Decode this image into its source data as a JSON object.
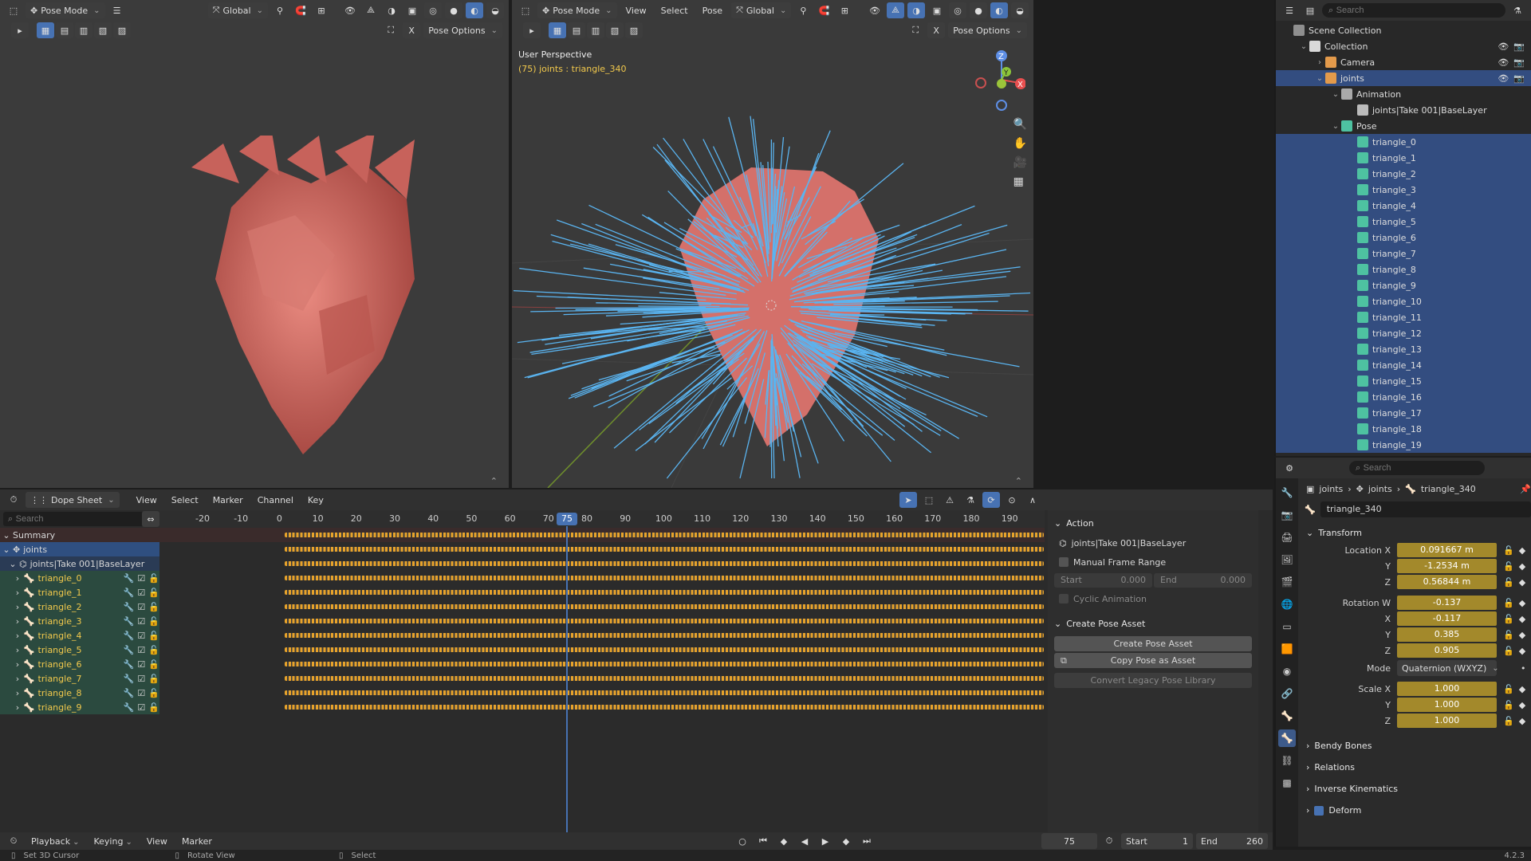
{
  "left_vp": {
    "mode": "Pose Mode",
    "orientation": "Global",
    "pose_options": "Pose Options"
  },
  "right_vp": {
    "mode": "Pose Mode",
    "menus": [
      "View",
      "Select",
      "Pose"
    ],
    "orientation": "Global",
    "pose_options": "Pose Options",
    "perspective": "User Perspective",
    "active_info": "(75) joints : triangle_340",
    "gizmo_labels": {
      "z": "Z",
      "y": "Y",
      "x": "X"
    }
  },
  "outliner": {
    "search_placeholder": "Search",
    "rows": [
      {
        "label": "Scene Collection",
        "indent": 0,
        "icon": "scene-collection-icon",
        "color": "#8f8f8f",
        "hl": false,
        "tri": ""
      },
      {
        "label": "Collection",
        "indent": 1,
        "icon": "collection-icon",
        "color": "#d9d9d9",
        "hl": false,
        "tri": "⌄"
      },
      {
        "label": "Camera",
        "indent": 2,
        "icon": "camera-icon",
        "color": "#e39a4b",
        "hl": false,
        "tri": "›"
      },
      {
        "label": "joints",
        "indent": 2,
        "icon": "armature-icon",
        "color": "#e39a4b",
        "hl": true,
        "tri": "⌄"
      },
      {
        "label": "Animation",
        "indent": 3,
        "icon": "animation-icon",
        "color": "#aaaaaa",
        "hl": false,
        "tri": "⌄"
      },
      {
        "label": "joints|Take 001|BaseLayer",
        "indent": 4,
        "icon": "action-icon",
        "color": "#bbbbbb",
        "hl": false,
        "tri": ""
      },
      {
        "label": "Pose",
        "indent": 3,
        "icon": "pose-icon",
        "color": "#4ec2a1",
        "hl": false,
        "tri": "⌄"
      },
      {
        "label": "triangle_0",
        "indent": 4,
        "icon": "bone-icon",
        "color": "#4ec2a1",
        "hl": true,
        "tri": ""
      },
      {
        "label": "triangle_1",
        "indent": 4,
        "icon": "bone-icon",
        "color": "#4ec2a1",
        "hl": true,
        "tri": ""
      },
      {
        "label": "triangle_2",
        "indent": 4,
        "icon": "bone-icon",
        "color": "#4ec2a1",
        "hl": true,
        "tri": ""
      },
      {
        "label": "triangle_3",
        "indent": 4,
        "icon": "bone-icon",
        "color": "#4ec2a1",
        "hl": true,
        "tri": ""
      },
      {
        "label": "triangle_4",
        "indent": 4,
        "icon": "bone-icon",
        "color": "#4ec2a1",
        "hl": true,
        "tri": ""
      },
      {
        "label": "triangle_5",
        "indent": 4,
        "icon": "bone-icon",
        "color": "#4ec2a1",
        "hl": true,
        "tri": ""
      },
      {
        "label": "triangle_6",
        "indent": 4,
        "icon": "bone-icon",
        "color": "#4ec2a1",
        "hl": true,
        "tri": ""
      },
      {
        "label": "triangle_7",
        "indent": 4,
        "icon": "bone-icon",
        "color": "#4ec2a1",
        "hl": true,
        "tri": ""
      },
      {
        "label": "triangle_8",
        "indent": 4,
        "icon": "bone-icon",
        "color": "#4ec2a1",
        "hl": true,
        "tri": ""
      },
      {
        "label": "triangle_9",
        "indent": 4,
        "icon": "bone-icon",
        "color": "#4ec2a1",
        "hl": true,
        "tri": ""
      },
      {
        "label": "triangle_10",
        "indent": 4,
        "icon": "bone-icon",
        "color": "#4ec2a1",
        "hl": true,
        "tri": ""
      },
      {
        "label": "triangle_11",
        "indent": 4,
        "icon": "bone-icon",
        "color": "#4ec2a1",
        "hl": true,
        "tri": ""
      },
      {
        "label": "triangle_12",
        "indent": 4,
        "icon": "bone-icon",
        "color": "#4ec2a1",
        "hl": true,
        "tri": ""
      },
      {
        "label": "triangle_13",
        "indent": 4,
        "icon": "bone-icon",
        "color": "#4ec2a1",
        "hl": true,
        "tri": ""
      },
      {
        "label": "triangle_14",
        "indent": 4,
        "icon": "bone-icon",
        "color": "#4ec2a1",
        "hl": true,
        "tri": ""
      },
      {
        "label": "triangle_15",
        "indent": 4,
        "icon": "bone-icon",
        "color": "#4ec2a1",
        "hl": true,
        "tri": ""
      },
      {
        "label": "triangle_16",
        "indent": 4,
        "icon": "bone-icon",
        "color": "#4ec2a1",
        "hl": true,
        "tri": ""
      },
      {
        "label": "triangle_17",
        "indent": 4,
        "icon": "bone-icon",
        "color": "#4ec2a1",
        "hl": true,
        "tri": ""
      },
      {
        "label": "triangle_18",
        "indent": 4,
        "icon": "bone-icon",
        "color": "#4ec2a1",
        "hl": true,
        "tri": ""
      },
      {
        "label": "triangle_19",
        "indent": 4,
        "icon": "bone-icon",
        "color": "#4ec2a1",
        "hl": true,
        "tri": ""
      }
    ]
  },
  "properties": {
    "search_placeholder": "Search",
    "breadcrumb": [
      "joints",
      "joints",
      "triangle_340"
    ],
    "bone_name": "triangle_340",
    "transform_title": "Transform",
    "location": [
      {
        "label": "Location X",
        "value": "0.091667 m"
      },
      {
        "label": "Y",
        "value": "-1.2534 m"
      },
      {
        "label": "Z",
        "value": "0.56844 m"
      }
    ],
    "rotation": [
      {
        "label": "Rotation W",
        "value": "-0.137"
      },
      {
        "label": "X",
        "value": "-0.117"
      },
      {
        "label": "Y",
        "value": "0.385"
      },
      {
        "label": "Z",
        "value": "0.905"
      }
    ],
    "mode_label": "Mode",
    "mode_value": "Quaternion (WXYZ)",
    "scale": [
      {
        "label": "Scale X",
        "value": "1.000"
      },
      {
        "label": "Y",
        "value": "1.000"
      },
      {
        "label": "Z",
        "value": "1.000"
      }
    ],
    "collapsed_panels": [
      "Bendy Bones",
      "Relations",
      "Inverse Kinematics",
      "Deform"
    ]
  },
  "dopesheet": {
    "editor": "Dope Sheet",
    "menus": [
      "View",
      "Select",
      "Marker",
      "Channel",
      "Key"
    ],
    "search_placeholder": "Search",
    "ticks": [
      "-20",
      "-10",
      "0",
      "10",
      "20",
      "30",
      "40",
      "50",
      "60",
      "70",
      "80",
      "90",
      "100",
      "110",
      "120",
      "130",
      "140",
      "150",
      "160",
      "170",
      "180",
      "190"
    ],
    "current_frame": "75",
    "summary": "Summary",
    "object": "joints",
    "action": "joints|Take 001|BaseLayer",
    "channels": [
      "triangle_0",
      "triangle_1",
      "triangle_2",
      "triangle_3",
      "triangle_4",
      "triangle_5",
      "triangle_6",
      "triangle_7",
      "triangle_8",
      "triangle_9"
    ]
  },
  "action_panel": {
    "title": "Action",
    "action_name": "joints|Take 001|BaseLayer",
    "manual_range": "Manual Frame Range",
    "start_label": "Start",
    "start_value": "0.000",
    "end_label": "End",
    "end_value": "0.000",
    "cyclic": "Cyclic Animation",
    "create_title": "Create Pose Asset",
    "create_btn": "Create Pose Asset",
    "copy_btn": "Copy Pose as Asset",
    "convert_btn": "Convert Legacy Pose Library"
  },
  "timeline": {
    "menus": [
      "Playback",
      "Keying",
      "View",
      "Marker"
    ],
    "frame": "75",
    "start_label": "Start",
    "start_value": "1",
    "end_label": "End",
    "end_value": "260"
  },
  "status": {
    "items": [
      "Set 3D Cursor",
      "Rotate View",
      "Select"
    ],
    "version": "4.2.3"
  },
  "colors": {
    "accent": "#4772b3",
    "keyframe": "#e8a32b",
    "bone": "#5ab4f0",
    "heart": "#d9736c"
  }
}
